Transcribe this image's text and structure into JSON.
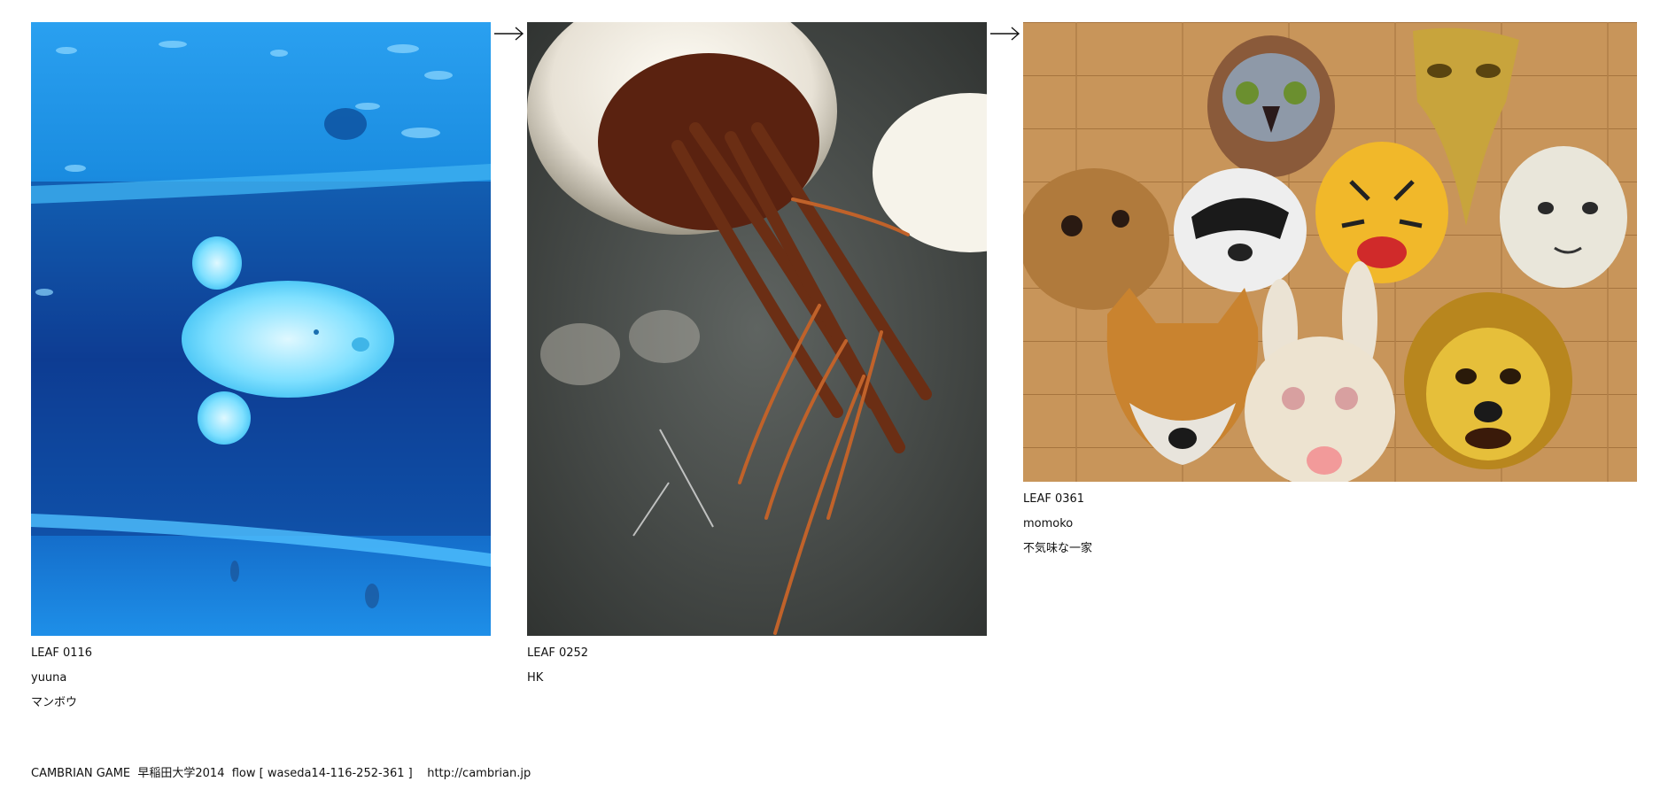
{
  "flow": {
    "leaves": [
      {
        "code": "LEAF 0116",
        "author": "yuuna",
        "title": "マンボウ",
        "image": "sunfish-aquarium-photo"
      },
      {
        "code": "LEAF 0252",
        "author": "HK",
        "title": "",
        "image": "jellyfish-photo"
      },
      {
        "code": "LEAF 0361",
        "author": "momoko",
        "title": "不気味な一家",
        "image": "animal-masks-photo"
      }
    ],
    "arrow_icon": "right-arrow-icon"
  },
  "footer": {
    "text": "CAMBRIAN GAME  早稲田大学2014  flow [ waseda14-116-252-361 ]    http://cambrian.jp"
  },
  "colors": {
    "background": "#ffffff",
    "text": "#111111",
    "aquarium_blue": "#1a8fe0",
    "jelly_dark": "#2e3230",
    "floor_wood": "#c8955a"
  }
}
